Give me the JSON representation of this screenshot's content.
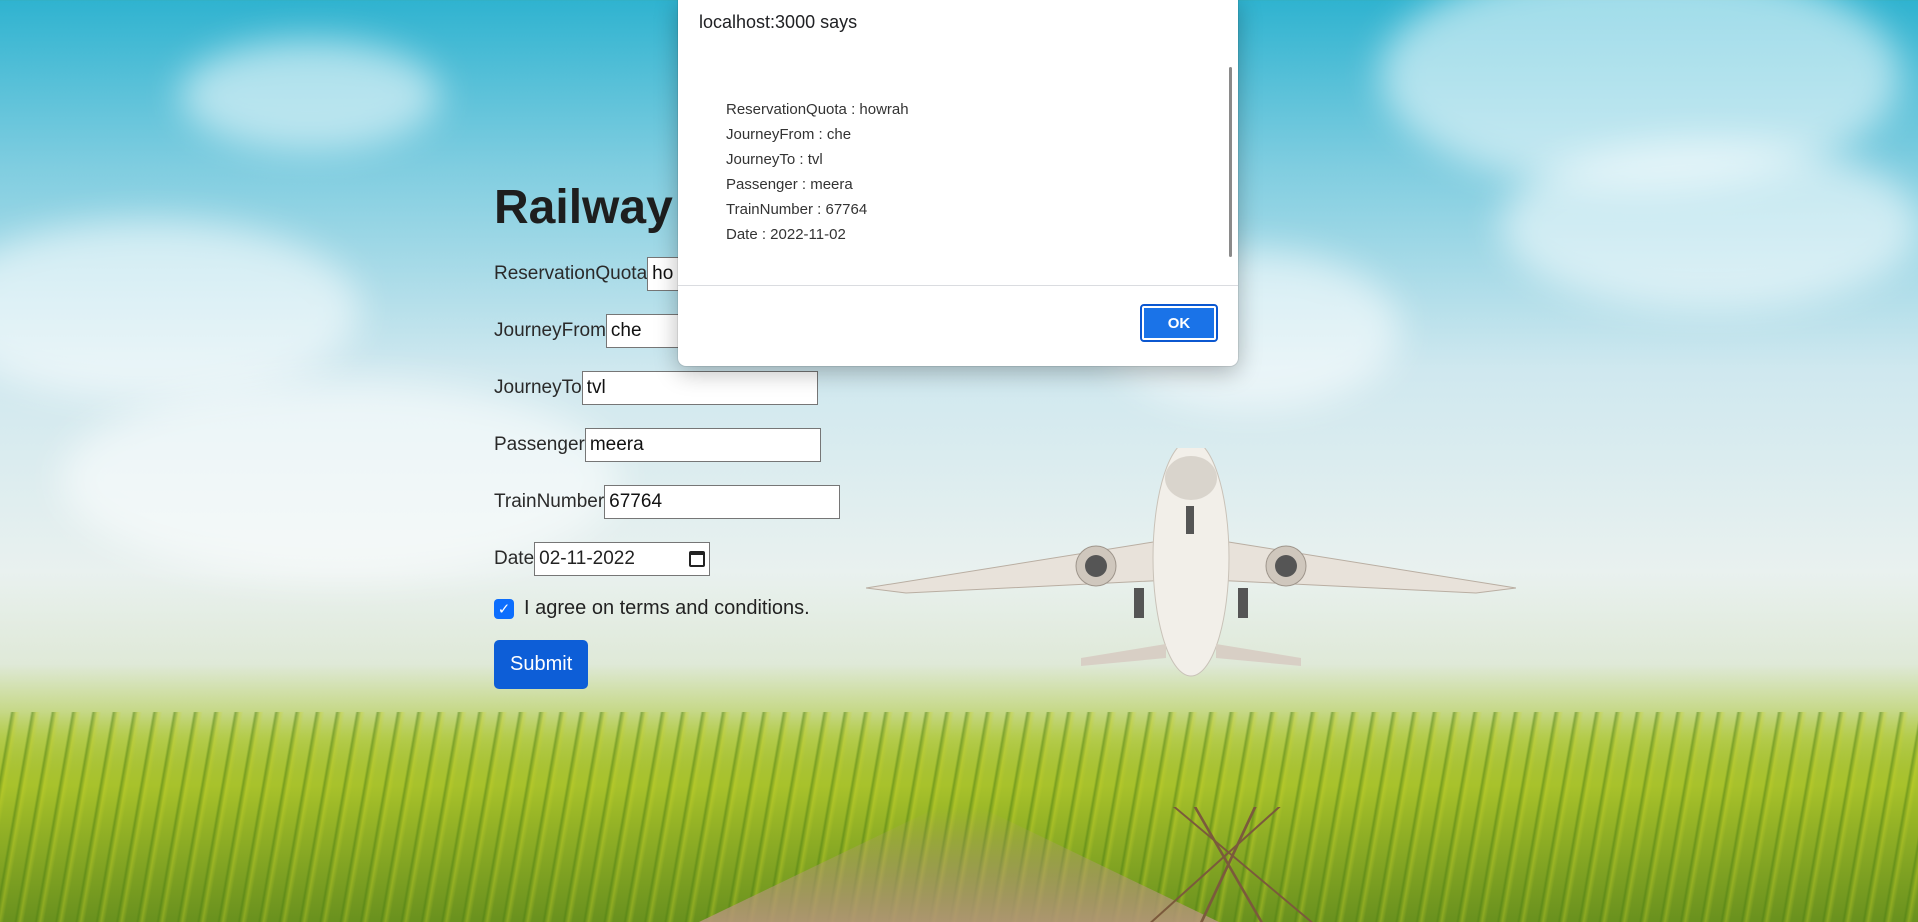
{
  "page": {
    "title": "Railway",
    "form": {
      "reservation_quota": {
        "label": "ReservationQuota",
        "value": "ho"
      },
      "journey_from": {
        "label": "JourneyFrom",
        "value": "che"
      },
      "journey_to": {
        "label": "JourneyTo",
        "value": "tvl"
      },
      "passenger": {
        "label": "Passenger",
        "value": "meera"
      },
      "train_number": {
        "label": "TrainNumber",
        "value": "67764"
      },
      "date": {
        "label": "Date",
        "value": "02-11-2022"
      },
      "terms_label": "I agree on terms and conditions.",
      "terms_checked": true,
      "submit_label": "Submit"
    }
  },
  "dialog": {
    "title": "localhost:3000 says",
    "lines": [
      "ReservationQuota : howrah",
      "JourneyFrom : che",
      "JourneyTo : tvl",
      "Passenger : meera",
      "TrainNumber : 67764",
      "Date : 2022-11-02"
    ],
    "ok_label": "OK"
  },
  "colors": {
    "primary_button": "#0d5ed7",
    "dialog_ok": "#1a73e8"
  }
}
